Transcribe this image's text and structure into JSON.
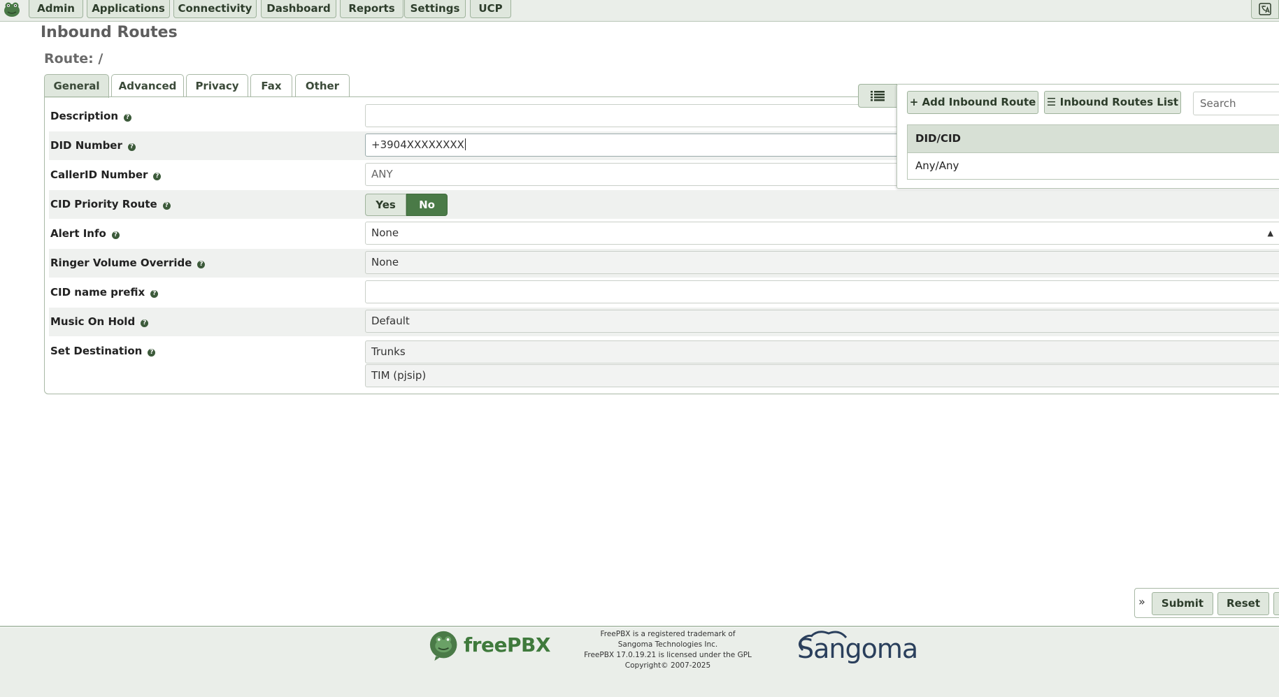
{
  "nav": {
    "items": [
      "Admin",
      "Applications",
      "Connectivity",
      "Dashboard",
      "Reports",
      "Settings",
      "UCP"
    ],
    "language_icon": "language-icon"
  },
  "page": {
    "title": "Inbound Routes",
    "route_label": "Route: /"
  },
  "tabs": [
    "General",
    "Advanced",
    "Privacy",
    "Fax",
    "Other"
  ],
  "active_tab": "General",
  "form": {
    "description": {
      "label": "Description",
      "value": ""
    },
    "did_number": {
      "label": "DID Number",
      "value": "+3904XXXXXXXX"
    },
    "callerid_number": {
      "label": "CallerID Number",
      "value": "ANY"
    },
    "cid_priority_route": {
      "label": "CID Priority Route",
      "yes": "Yes",
      "no": "No",
      "selected": "No"
    },
    "alert_info": {
      "label": "Alert Info",
      "value": "None"
    },
    "ringer_volume_override": {
      "label": "Ringer Volume Override",
      "value": "None"
    },
    "cid_name_prefix": {
      "label": "CID name prefix",
      "value": ""
    },
    "music_on_hold": {
      "label": "Music On Hold",
      "value": "Default"
    },
    "set_destination": {
      "label": "Set Destination",
      "value": "Trunks",
      "sub_value": "TIM (pjsip)"
    }
  },
  "side_panel": {
    "add_button": "Add Inbound Route",
    "list_button": "Inbound Routes List",
    "search_placeholder": "Search",
    "table_header": "DID/CID",
    "rows": [
      "Any/Any"
    ]
  },
  "actions": {
    "collapse": "»",
    "submit": "Submit",
    "reset": "Reset"
  },
  "footer": {
    "freepbx_logo_text": "freePBX",
    "line1": "FreePBX is a registered trademark of",
    "line2": "Sangoma Technologies Inc.",
    "line3": "FreePBX 17.0.19.21 is licensed under the GPL",
    "line4": "Copyright© 2007-2025",
    "sangoma_logo_text": "Sangoma"
  },
  "colors": {
    "accent": "#4a7a47",
    "button_bg": "#dfe7dd",
    "row_alt": "#eff1ef",
    "header_bg": "#eaeee9"
  }
}
